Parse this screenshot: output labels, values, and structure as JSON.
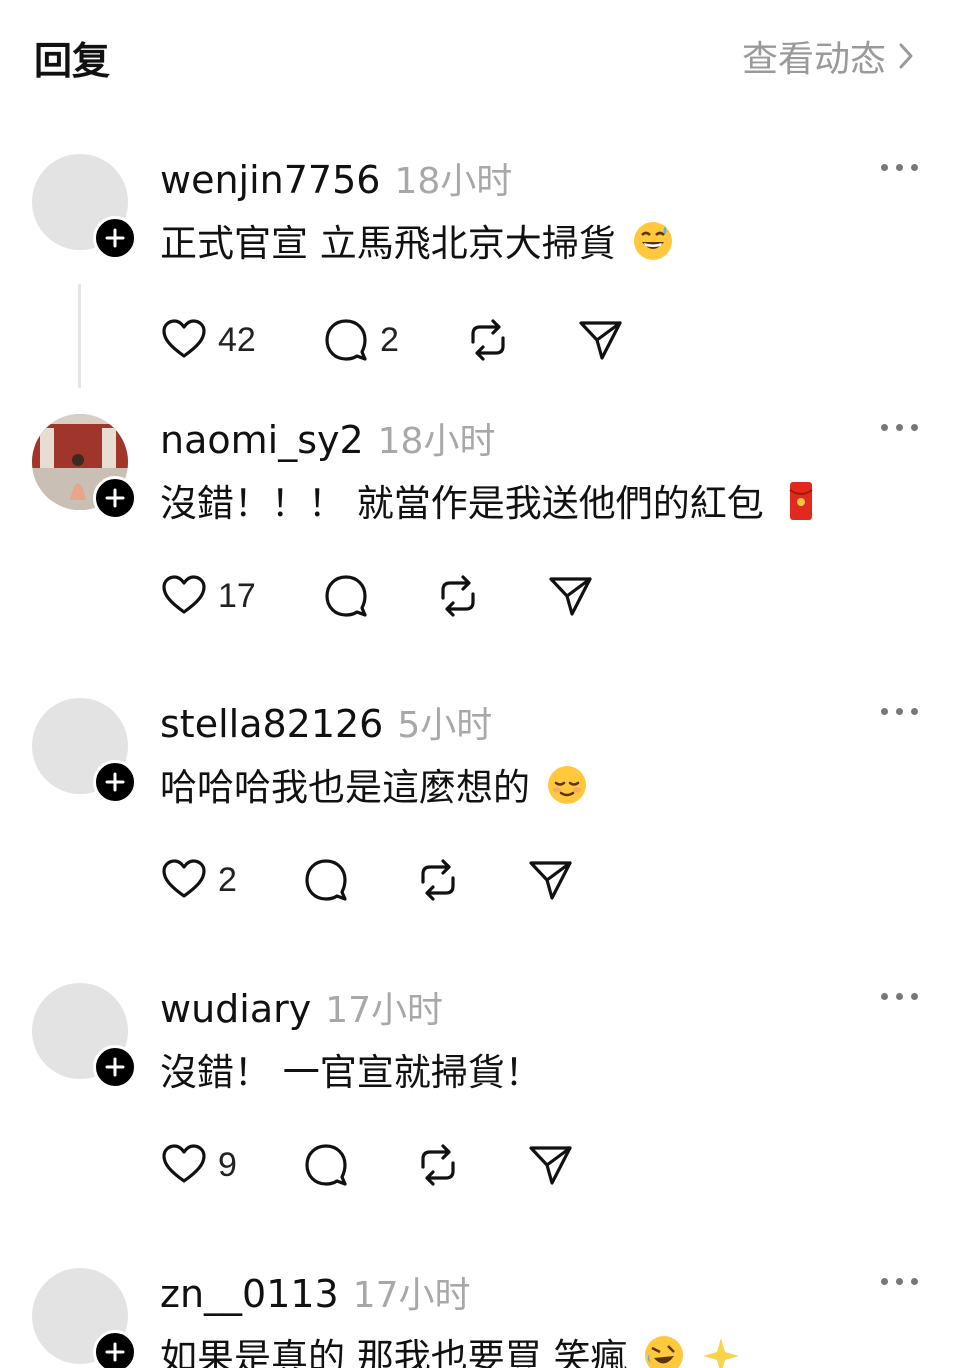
{
  "header": {
    "title": "回复",
    "view_activity": "查看动态"
  },
  "posts": [
    {
      "username": "wenjin7756",
      "time": "18小时",
      "text": "正式官宣 立馬飛北京大掃貨",
      "emoji": "grinning-sweat-emoji",
      "likes": "42",
      "replies": "2"
    },
    {
      "username": "naomi_sy2",
      "time": "18小时",
      "text": "沒錯！！！ 就當作是我送他們的紅包",
      "emoji": "red-envelope-emoji",
      "likes": "17",
      "replies": ""
    },
    {
      "username": "stella82126",
      "time": "5小时",
      "text": "哈哈哈我也是這麼想的",
      "emoji": "relieved-face-emoji",
      "likes": "2",
      "replies": ""
    },
    {
      "username": "wudiary",
      "time": "17小时",
      "text": "沒錯！ 一官宣就掃貨！",
      "emoji": "",
      "likes": "9",
      "replies": ""
    },
    {
      "username": "zn__0113",
      "time": "17小时",
      "text": "如果是真的 那我也要買 笑瘋",
      "emoji": "rolling-laughing-emoji",
      "likes": "",
      "replies": ""
    }
  ],
  "icons": {
    "like": "heart-icon",
    "reply": "comment-icon",
    "repost": "repost-icon",
    "share": "send-icon",
    "more": "more-dots-icon",
    "follow": "plus-icon",
    "chevron": "chevron-right-icon"
  },
  "colors": {
    "text": "#111111",
    "secondary": "#a8a8a8",
    "avatar_placeholder": "#e3e3e3"
  }
}
